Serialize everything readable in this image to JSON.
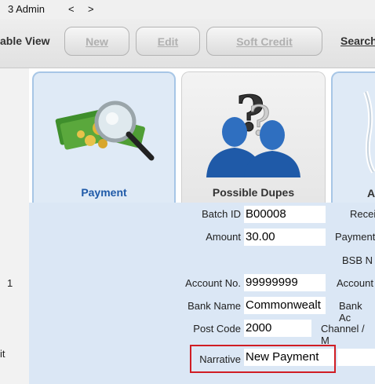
{
  "topbar": {
    "title": "3 Admin",
    "back": "<",
    "forward": ">"
  },
  "toolbar": {
    "table_view_label": "able View",
    "new_label": "New",
    "edit_label": "Edit",
    "soft_credit_label": "Soft Credit",
    "search_label": "Search"
  },
  "left_panel": {
    "item1": "1",
    "item2": "it"
  },
  "tiles": [
    {
      "label": "Payment",
      "icon": "money-magnifier-icon"
    },
    {
      "label": "Possible Dupes",
      "icon": "question-people-icon"
    },
    {
      "label": "A",
      "icon": "partial-icon"
    }
  ],
  "form": {
    "batch_id": {
      "label": "Batch ID",
      "value": "B00008"
    },
    "amount": {
      "label": "Amount",
      "value": "30.00"
    },
    "account_no": {
      "label": "Account No.",
      "value": "99999999"
    },
    "bank_name": {
      "label": "Bank Name",
      "value": "Commonwealt"
    },
    "post_code": {
      "label": "Post Code",
      "value": "2000"
    },
    "narrative": {
      "label": "Narrative",
      "value": "New Payment"
    }
  },
  "right_labels": {
    "receipt": "Recei",
    "payment": "Payment",
    "bsb": "BSB N",
    "account": "Account",
    "bank_account": "Bank Ac",
    "channel": "Channel / M"
  },
  "colors": {
    "tile_accent": "#1f5aa8",
    "highlight": "#d01d24",
    "content_bg": "#dbe7f5"
  }
}
